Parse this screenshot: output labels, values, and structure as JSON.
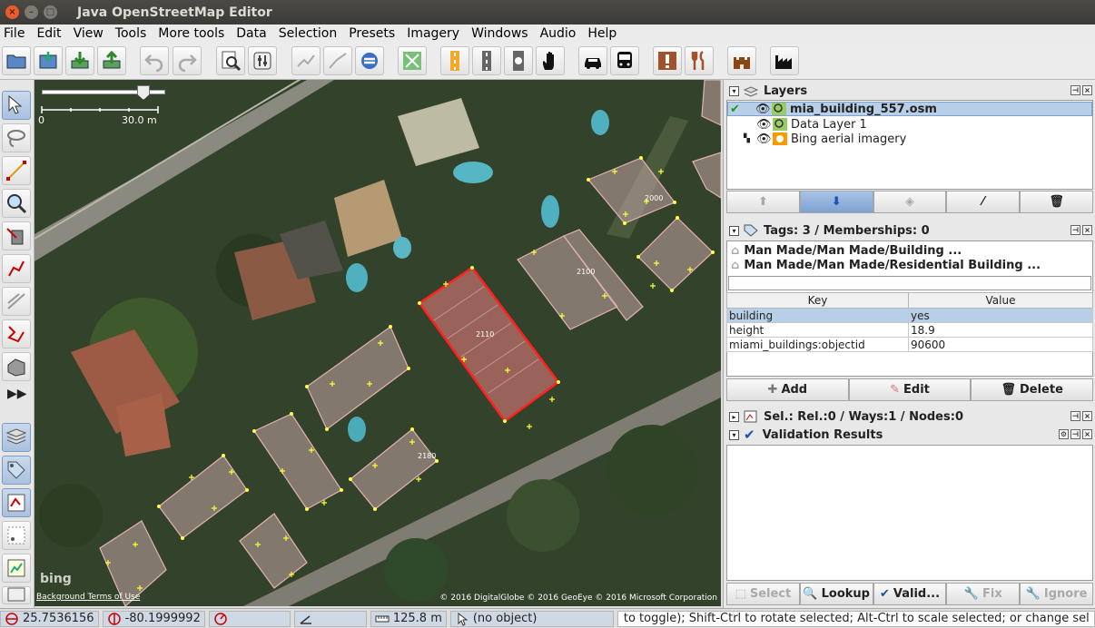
{
  "window": {
    "title": "Java OpenStreetMap Editor"
  },
  "menu": [
    "File",
    "Edit",
    "View",
    "Tools",
    "More tools",
    "Data",
    "Selection",
    "Presets",
    "Imagery",
    "Windows",
    "Audio",
    "Help"
  ],
  "map": {
    "scale_zero": "0",
    "scale_label": "30.0 m",
    "house_numbers": [
      "2000",
      "2100",
      "2110",
      "2180"
    ],
    "logo": "bing",
    "attribution_left": "Background Terms of Use",
    "attribution_right": "© 2016 DigitalGlobe © 2016 GeoEye © 2016 Microsoft Corporation"
  },
  "layers_panel": {
    "title": "Layers",
    "layers": [
      {
        "name": "mia_building_557.osm",
        "active": true
      },
      {
        "name": "Data Layer 1",
        "active": false
      },
      {
        "name": "Bing aerial imagery",
        "active": false
      }
    ]
  },
  "tags_panel": {
    "title": "Tags: 3 / Memberships: 0",
    "presets": [
      "Man Made/Man Made/Building ...",
      "Man Made/Man Made/Residential Building ..."
    ],
    "headers": {
      "key": "Key",
      "value": "Value"
    },
    "rows": [
      {
        "key": "building",
        "value": "yes"
      },
      {
        "key": "height",
        "value": "18.9"
      },
      {
        "key": "miami_buildings:objectid",
        "value": "90600"
      }
    ],
    "buttons": {
      "add": "Add",
      "edit": "Edit",
      "delete": "Delete"
    }
  },
  "selection_panel": {
    "title": "Sel.: Rel.:0 / Ways:1 / Nodes:0"
  },
  "validation_panel": {
    "title": "Validation Results",
    "buttons": {
      "select": "Select",
      "lookup": "Lookup",
      "validate": "Valid...",
      "fix": "Fix",
      "ignore": "Ignore"
    }
  },
  "status": {
    "lat": "25.7536156",
    "lon": "-80.1999992",
    "distance": "125.8 m",
    "object": "(no object)",
    "help": "to toggle); Shift-Ctrl to rotate selected; Alt-Ctrl to scale selected; or change sel"
  }
}
